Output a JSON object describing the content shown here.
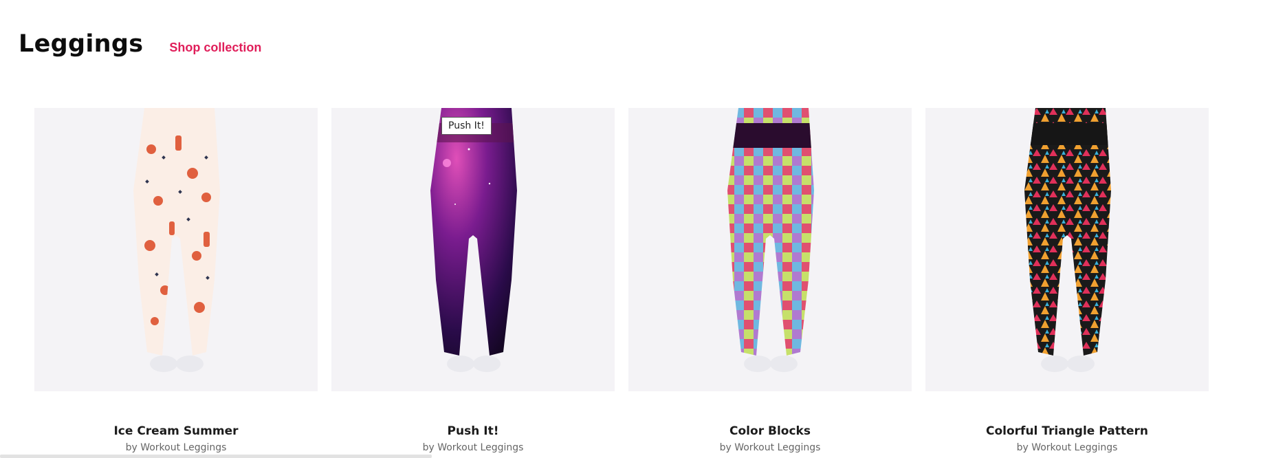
{
  "section": {
    "title": "Leggings",
    "shop_link": "Shop collection",
    "accent_color": "#e01e5a"
  },
  "products": [
    {
      "name": "Ice Cream Summer",
      "by": "by Workout Leggings",
      "pattern": "ice-cream"
    },
    {
      "name": "Push It!",
      "by": "by Workout Leggings",
      "pattern": "galaxy",
      "tooltip": "Push It!"
    },
    {
      "name": "Color Blocks",
      "by": "by Workout Leggings",
      "pattern": "color-blocks"
    },
    {
      "name": "Colorful Triangle Pattern",
      "by": "by Workout Leggings",
      "pattern": "triangles"
    }
  ]
}
